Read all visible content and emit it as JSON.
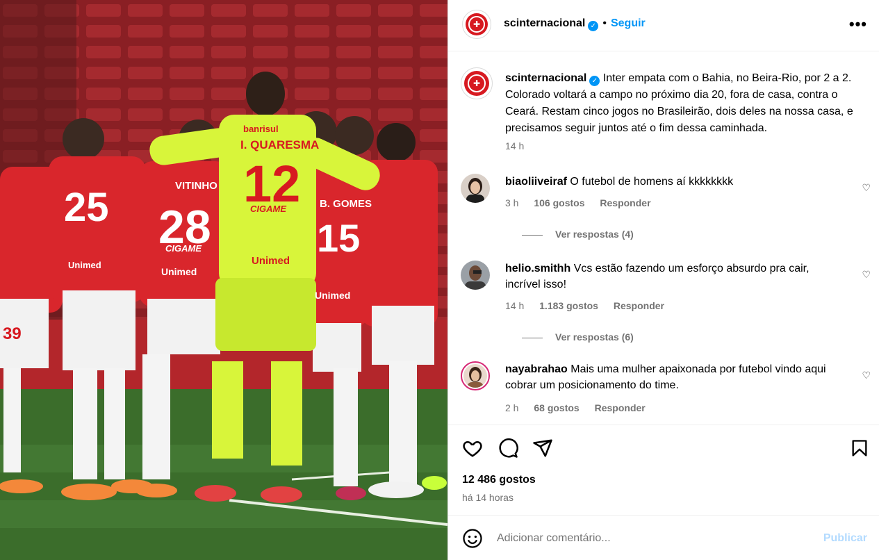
{
  "post": {
    "photo_alt": "Jogadores do Internacional reunidos em campo",
    "jersey_numbers": {
      "keeper": "12",
      "keeper_name": "I. QUARESMA",
      "p28": "28",
      "p28_name": "VITINHO",
      "p25": "25",
      "p15": "15",
      "p15_name": "B. GOMES",
      "p39": "39"
    },
    "sponsor_top": "banrisul",
    "sponsor_chest": "CIGAME",
    "sponsor_belly": "Unimed"
  },
  "header": {
    "username": "scinternacional",
    "separator": "•",
    "follow_label": "Seguir",
    "more_label": "•••"
  },
  "caption": {
    "username": "scinternacional",
    "text": "Inter empata com o Bahia, no Beira-Rio, por 2 a 2. Colorado voltará a campo no próximo dia 20, fora de casa, contra o Ceará. Restam cinco jogos no Brasileirão, dois deles na nossa casa, e precisamos seguir juntos até o fim dessa caminhada.",
    "time": "14 h"
  },
  "comments": [
    {
      "username": "biaoliiveiraf",
      "text": "O futebol de homens aí kkkkkkkk",
      "time": "3 h",
      "likes": "106 gostos",
      "reply_label": "Responder",
      "view_replies": "Ver respostas (4)"
    },
    {
      "username": "helio.smithh",
      "text": "Vcs estão fazendo um esforço absurdo pra cair, incrível isso!",
      "time": "14 h",
      "likes": "1.183 gostos",
      "reply_label": "Responder",
      "view_replies": "Ver respostas (6)"
    },
    {
      "username": "nayabrahao",
      "text": "Mais uma mulher apaixonada por futebol vindo aqui cobrar um posicionamento do time.",
      "time": "2 h",
      "likes": "68 gostos",
      "reply_label": "Responder"
    }
  ],
  "actions": {
    "likes": "12 486 gostos",
    "time": "há 14 horas"
  },
  "add_comment": {
    "placeholder": "Adicionar comentário...",
    "publish_label": "Publicar"
  },
  "colors": {
    "accent": "#0095f6",
    "inter_red": "#d71920",
    "muted": "#737373"
  }
}
